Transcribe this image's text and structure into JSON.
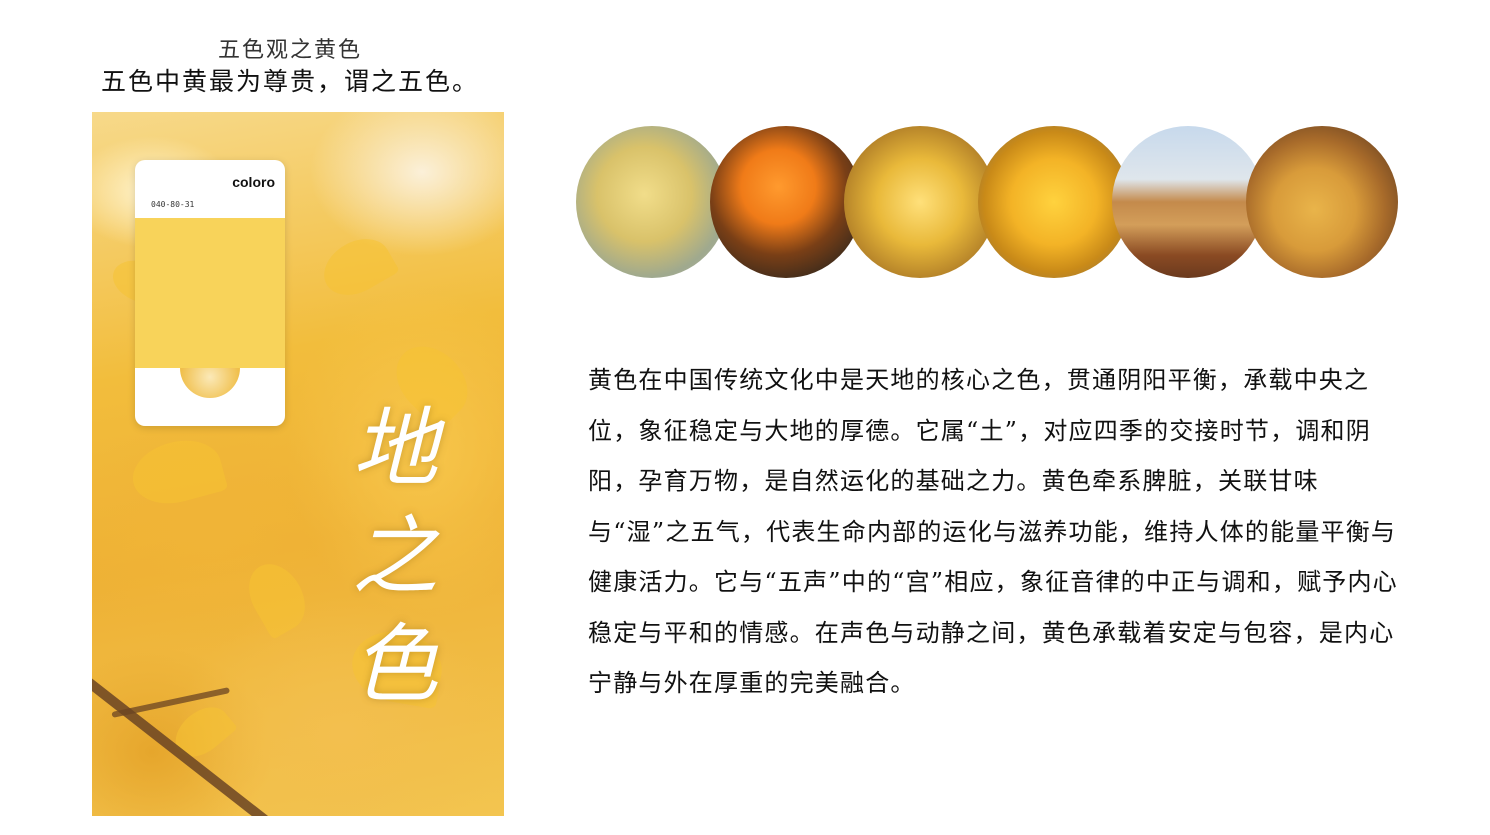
{
  "header": {
    "subtitle": "五色观之黄色",
    "headline": "五色中黄最为尊贵，谓之五色。"
  },
  "poster": {
    "card": {
      "brand": "coloro",
      "code": "040-80-31",
      "swatch_color": "#f8d35a"
    },
    "vertical_title": [
      "地",
      "之",
      "色"
    ]
  },
  "gallery": [
    {
      "name": "imperial-robe",
      "dominant_color": "#e2cf7a"
    },
    {
      "name": "marigold-flower",
      "dominant_color": "#f07b18"
    },
    {
      "name": "golden-crown",
      "dominant_color": "#e9b93a"
    },
    {
      "name": "ginkgo-leaves",
      "dominant_color": "#f3b326"
    },
    {
      "name": "yellow-earth-landscape",
      "dominant_color": "#c48a4b"
    },
    {
      "name": "millet-grain",
      "dominant_color": "#d89b3a"
    }
  ],
  "body": {
    "paragraph": "黄色在中国传统文化中是天地的核心之色，贯通阴阳平衡，承载中央之位，象征稳定与大地的厚德。它属“土”，对应四季的交接时节，调和阴阳，孕育万物，是自然运化的基础之力。黄色牵系脾脏，关联甘味与“湿”之五气，代表生命内部的运化与滋养功能，维持人体的能量平衡与健康活力。它与“五声”中的“宫”相应，象征音律的中正与调和，赋予内心稳定与平和的情感。在声色与动静之间，黄色承载着安定与包容，是内心宁静与外在厚重的完美融合。"
  }
}
